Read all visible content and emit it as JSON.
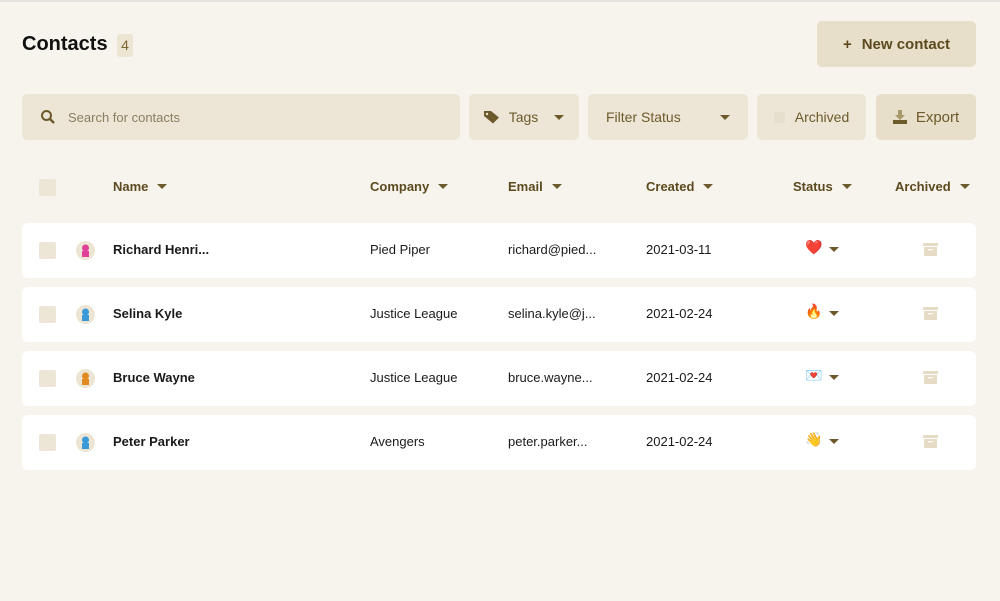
{
  "header": {
    "title": "Contacts",
    "count": "4",
    "new_contact_label": "New contact"
  },
  "toolbar": {
    "search_placeholder": "Search for contacts",
    "tags_label": "Tags",
    "filter_status_label": "Filter Status",
    "archived_label": "Archived",
    "export_label": "Export"
  },
  "columns": {
    "name": "Name",
    "company": "Company",
    "email": "Email",
    "created": "Created",
    "status": "Status",
    "archived": "Archived"
  },
  "rows": [
    {
      "name": "Richard Henri...",
      "company": "Pied Piper",
      "email": "richard@pied...",
      "created": "2021-03-11",
      "status": "❤️",
      "avatar_color": "#e0409a"
    },
    {
      "name": "Selina Kyle",
      "company": "Justice League",
      "email": "selina.kyle@j...",
      "created": "2021-02-24",
      "status": "🔥",
      "avatar_color": "#3a9ad9"
    },
    {
      "name": "Bruce Wayne",
      "company": "Justice League",
      "email": "bruce.wayne...",
      "created": "2021-02-24",
      "status": "💌",
      "avatar_color": "#e08a20"
    },
    {
      "name": "Peter Parker",
      "company": "Avengers",
      "email": "peter.parker...",
      "created": "2021-02-24",
      "status": "👋",
      "avatar_color": "#3a9ad9"
    }
  ]
}
